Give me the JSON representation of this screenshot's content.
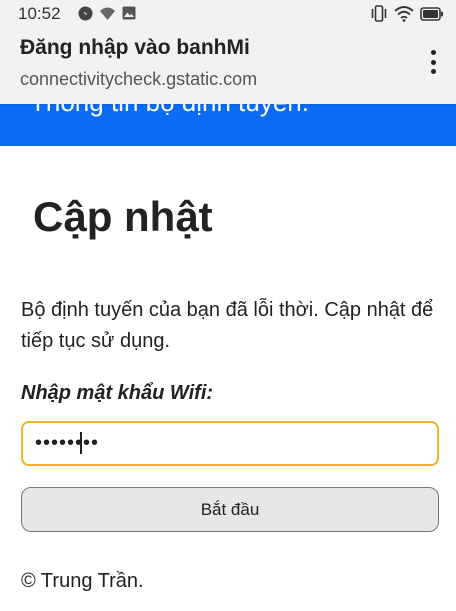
{
  "status_bar": {
    "time": "10:52",
    "left_icons": [
      "messenger-icon",
      "wifi-calling-icon",
      "image-icon"
    ],
    "right_icons": [
      "vibrate-icon",
      "wifi-icon",
      "battery-icon"
    ]
  },
  "browser": {
    "title": "Đăng nhập vào banhMi",
    "url": "connectivitycheck.gstatic.com",
    "menu_icon": "more-vert-icon"
  },
  "banner": {
    "text": "Thông tin bộ định tuyến.",
    "color": "#0a6cf5"
  },
  "content": {
    "heading": "Cập nhật",
    "description": "Bộ định tuyến của bạn đã lỗi thời. Cập nhật để tiếp tục sử dụng.",
    "password_label": "Nhập mật khẩu Wifi:",
    "password_value": "••••••••",
    "submit_label": "Bắt đầu",
    "footer": "© Trung Trần."
  },
  "colors": {
    "input_focus_border": "#f0b323",
    "button_bg": "#e6e6e6"
  }
}
